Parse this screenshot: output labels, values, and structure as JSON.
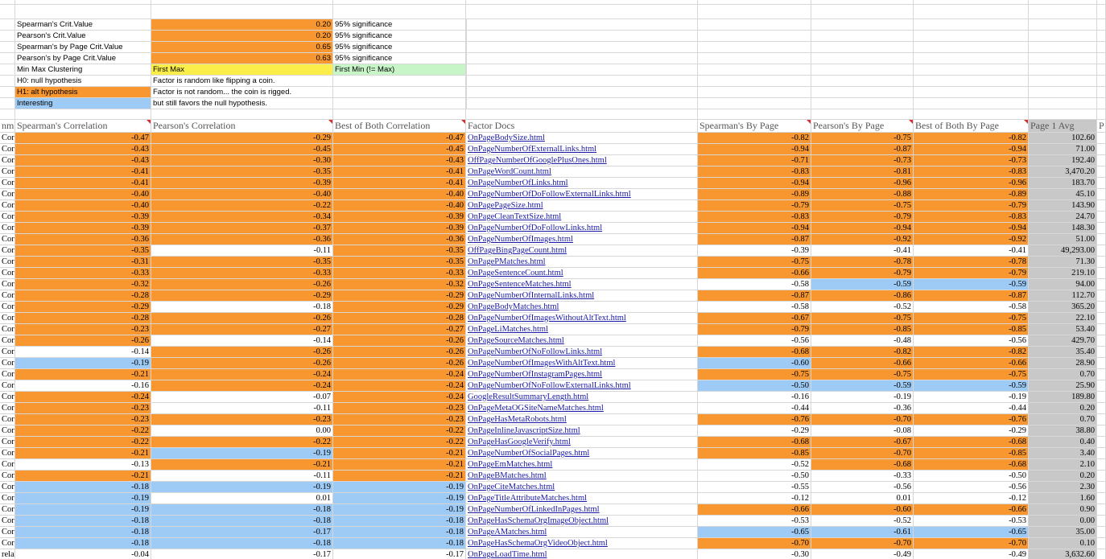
{
  "colors": {
    "orange": "#f8972f",
    "blue": "#9dcbf5",
    "yellow": "#fcee4a",
    "green": "#c7f5c8",
    "gray": "#c8c8c8",
    "link": "#1a1aa6"
  },
  "settings": [
    {
      "label": "Spearman's Crit.Value",
      "label_color": "w",
      "value": "0.20",
      "value_color": "o",
      "note": "95% significance",
      "note_color": "w"
    },
    {
      "label": "Pearson's Crit.Value",
      "label_color": "w",
      "value": "0.20",
      "value_color": "o",
      "note": "95% significance",
      "note_color": "w"
    },
    {
      "label": "Spearman's by Page Crit.Value",
      "label_color": "w",
      "value": "0.65",
      "value_color": "o",
      "note": "95% significance",
      "note_color": "w"
    },
    {
      "label": "Pearson's by Page Crit.Value",
      "label_color": "w",
      "value": "0.63",
      "value_color": "o",
      "note": "95% significance",
      "note_color": "w"
    },
    {
      "label": "Min Max Clustering",
      "label_color": "w",
      "value": "First Max",
      "value_color": "y",
      "note": "First Min (!= Max)",
      "note_color": "g"
    },
    {
      "label": "H0: null hypothesis",
      "label_color": "w",
      "value": "Factor is random like flipping a coin.",
      "value_color": "w",
      "note": "",
      "note_color": "w"
    },
    {
      "label": "H1: alt hypothesis",
      "label_color": "o",
      "value": "Factor is not random... the coin is rigged.",
      "value_color": "w",
      "note": "",
      "note_color": "w"
    },
    {
      "label": "Interesting",
      "label_color": "b",
      "value": "but still favors the null hypothesis.",
      "value_color": "w",
      "note": "",
      "note_color": "w"
    }
  ],
  "headers": {
    "col_a": "nm",
    "spearman": "Spearman's Correlation",
    "pearson": "Pearson's Correlation",
    "both": "Best of Both Correlation",
    "docs": "Factor Docs",
    "spearman_page": "Spearman's By Page",
    "pearson_page": "Pearson's By Page",
    "both_page": "Best of Both By Page",
    "avg": "Page 1 Avg",
    "last": "P"
  },
  "rows": [
    {
      "a": "Corr",
      "sp": "-0.47",
      "pe": "-0.29",
      "bb": "-0.47",
      "doc": "OnPageBodySize.html",
      "spp": "-0.82",
      "pep": "-0.75",
      "bbp": "-0.82",
      "avg": "102.60"
    },
    {
      "a": "Corr",
      "sp": "-0.43",
      "pe": "-0.45",
      "bb": "-0.45",
      "doc": "OnPageNumberOfExternalLinks.html",
      "spp": "-0.94",
      "pep": "-0.87",
      "bbp": "-0.94",
      "avg": "71.00"
    },
    {
      "a": "Corr",
      "sp": "-0.43",
      "pe": "-0.30",
      "bb": "-0.43",
      "doc": "OffPageNumberOfGooglePlusOnes.html",
      "spp": "-0.71",
      "pep": "-0.73",
      "bbp": "-0.73",
      "avg": "192.40"
    },
    {
      "a": "Corr",
      "sp": "-0.41",
      "pe": "-0.35",
      "bb": "-0.41",
      "doc": "OnPageWordCount.html",
      "spp": "-0.83",
      "pep": "-0.81",
      "bbp": "-0.83",
      "avg": "3,470.20"
    },
    {
      "a": "Corr",
      "sp": "-0.41",
      "pe": "-0.39",
      "bb": "-0.41",
      "doc": "OnPageNumberOfLinks.html",
      "spp": "-0.94",
      "pep": "-0.96",
      "bbp": "-0.96",
      "avg": "183.70"
    },
    {
      "a": "Corr",
      "sp": "-0.40",
      "pe": "-0.40",
      "bb": "-0.40",
      "doc": "OnPageNumberOfDoFollowExternalLinks.html",
      "spp": "-0.89",
      "pep": "-0.88",
      "bbp": "-0.89",
      "avg": "45.10"
    },
    {
      "a": "Corr",
      "sp": "-0.40",
      "pe": "-0.22",
      "bb": "-0.40",
      "doc": "OnPagePageSize.html",
      "spp": "-0.79",
      "pep": "-0.75",
      "bbp": "-0.79",
      "avg": "143.90"
    },
    {
      "a": "Corr",
      "sp": "-0.39",
      "pe": "-0.34",
      "bb": "-0.39",
      "doc": "OnPageCleanTextSize.html",
      "spp": "-0.83",
      "pep": "-0.79",
      "bbp": "-0.83",
      "avg": "24.70"
    },
    {
      "a": "Corr",
      "sp": "-0.39",
      "pe": "-0.37",
      "bb": "-0.39",
      "doc": "OnPageNumberOfDoFollowLinks.html",
      "spp": "-0.94",
      "pep": "-0.94",
      "bbp": "-0.94",
      "avg": "148.30"
    },
    {
      "a": "Corr",
      "sp": "-0.36",
      "pe": "-0.36",
      "bb": "-0.36",
      "doc": "OnPageNumberOfImages.html",
      "spp": "-0.87",
      "pep": "-0.92",
      "bbp": "-0.92",
      "avg": "51.00"
    },
    {
      "a": "Corr",
      "sp": "-0.35",
      "pe": "-0.11",
      "bb": "-0.35",
      "doc": "OffPageBingPageCount.html",
      "spp": "-0.39",
      "pep": "-0.41",
      "bbp": "-0.41",
      "avg": "49,293.00"
    },
    {
      "a": "Corr",
      "sp": "-0.31",
      "pe": "-0.35",
      "bb": "-0.35",
      "doc": "OnPagePMatches.html",
      "spp": "-0.75",
      "pep": "-0.78",
      "bbp": "-0.78",
      "avg": "71.30"
    },
    {
      "a": "Corr",
      "sp": "-0.33",
      "pe": "-0.33",
      "bb": "-0.33",
      "doc": "OnPageSentenceCount.html",
      "spp": "-0.66",
      "pep": "-0.79",
      "bbp": "-0.79",
      "avg": "219.10"
    },
    {
      "a": "Corr",
      "sp": "-0.32",
      "pe": "-0.26",
      "bb": "-0.32",
      "doc": "OnPageSentenceMatches.html",
      "spp": "-0.58",
      "pep": "-0.59",
      "bbp": "-0.59",
      "avg": "94.00"
    },
    {
      "a": "Corr",
      "sp": "-0.28",
      "pe": "-0.29",
      "bb": "-0.29",
      "doc": "OnPageNumberOfInternalLinks.html",
      "spp": "-0.87",
      "pep": "-0.86",
      "bbp": "-0.87",
      "avg": "112.70"
    },
    {
      "a": "Corr",
      "sp": "-0.29",
      "pe": "-0.18",
      "bb": "-0.29",
      "doc": "OnPageBodyMatches.html",
      "spp": "-0.58",
      "pep": "-0.52",
      "bbp": "-0.58",
      "avg": "365.20"
    },
    {
      "a": "Corr",
      "sp": "-0.28",
      "pe": "-0.26",
      "bb": "-0.28",
      "doc": "OnPageNumberOfImagesWithoutAltText.html",
      "spp": "-0.67",
      "pep": "-0.75",
      "bbp": "-0.75",
      "avg": "22.10"
    },
    {
      "a": "Corr",
      "sp": "-0.23",
      "pe": "-0.27",
      "bb": "-0.27",
      "doc": "OnPageLiMatches.html",
      "spp": "-0.79",
      "pep": "-0.85",
      "bbp": "-0.85",
      "avg": "53.40"
    },
    {
      "a": "Corr",
      "sp": "-0.26",
      "pe": "-0.14",
      "bb": "-0.26",
      "doc": "OnPageSourceMatches.html",
      "spp": "-0.56",
      "pep": "-0.48",
      "bbp": "-0.56",
      "avg": "429.70"
    },
    {
      "a": "Corr",
      "sp": "-0.14",
      "pe": "-0.26",
      "bb": "-0.26",
      "doc": "OnPageNumberOfNoFollowLinks.html",
      "spp": "-0.68",
      "pep": "-0.82",
      "bbp": "-0.82",
      "avg": "35.40"
    },
    {
      "a": "Corr",
      "sp": "-0.19",
      "pe": "-0.26",
      "bb": "-0.26",
      "doc": "OnPageNumberOfImagesWithAltText.html",
      "spp": "-0.60",
      "pep": "-0.66",
      "bbp": "-0.66",
      "avg": "28.90"
    },
    {
      "a": "Corr",
      "sp": "-0.21",
      "pe": "-0.24",
      "bb": "-0.24",
      "doc": "OnPageNumberOfInstagramPages.html",
      "spp": "-0.75",
      "pep": "-0.75",
      "bbp": "-0.75",
      "avg": "0.70"
    },
    {
      "a": "Corr",
      "sp": "-0.16",
      "pe": "-0.24",
      "bb": "-0.24",
      "doc": "OnPageNumberOfNoFollowExternalLinks.html",
      "spp": "-0.50",
      "pep": "-0.59",
      "bbp": "-0.59",
      "avg": "25.90"
    },
    {
      "a": "Corr",
      "sp": "-0.24",
      "pe": "-0.07",
      "bb": "-0.24",
      "doc": "GoogleResultSummaryLength.html",
      "spp": "-0.16",
      "pep": "-0.19",
      "bbp": "-0.19",
      "avg": "189.80"
    },
    {
      "a": "Corr",
      "sp": "-0.23",
      "pe": "-0.11",
      "bb": "-0.23",
      "doc": "OnPageMetaOGSiteNameMatches.html",
      "spp": "-0.44",
      "pep": "-0.36",
      "bbp": "-0.44",
      "avg": "0.20"
    },
    {
      "a": "Corr",
      "sp": "-0.23",
      "pe": "-0.23",
      "bb": "-0.23",
      "doc": "OnPageHasMetaRobots.html",
      "spp": "-0.76",
      "pep": "-0.70",
      "bbp": "-0.76",
      "avg": "0.70"
    },
    {
      "a": "Corr",
      "sp": "-0.22",
      "pe": "0.00",
      "bb": "-0.22",
      "doc": "OnPageInlineJavascriptSize.html",
      "spp": "-0.29",
      "pep": "-0.08",
      "bbp": "-0.29",
      "avg": "38.80"
    },
    {
      "a": "Corr",
      "sp": "-0.22",
      "pe": "-0.22",
      "bb": "-0.22",
      "doc": "OnPageHasGoogleVerify.html",
      "spp": "-0.68",
      "pep": "-0.67",
      "bbp": "-0.68",
      "avg": "0.40"
    },
    {
      "a": "Corr",
      "sp": "-0.21",
      "pe": "-0.19",
      "bb": "-0.21",
      "doc": "OnPageNumberOfSocialPages.html",
      "spp": "-0.85",
      "pep": "-0.70",
      "bbp": "-0.85",
      "avg": "3.40"
    },
    {
      "a": "Corr",
      "sp": "-0.13",
      "pe": "-0.21",
      "bb": "-0.21",
      "doc": "OnPageEmMatches.html",
      "spp": "-0.52",
      "pep": "-0.68",
      "bbp": "-0.68",
      "avg": "2.10"
    },
    {
      "a": "Corr",
      "sp": "-0.21",
      "pe": "-0.11",
      "bb": "-0.21",
      "doc": "OnPageBMatches.html",
      "spp": "-0.50",
      "pep": "-0.33",
      "bbp": "-0.50",
      "avg": "0.20"
    },
    {
      "a": "Corre",
      "sp": "-0.18",
      "pe": "-0.19",
      "bb": "-0.19",
      "doc": "OnPageCiteMatches.html",
      "spp": "-0.55",
      "pep": "-0.56",
      "bbp": "-0.56",
      "avg": "2.30"
    },
    {
      "a": "Corre",
      "sp": "-0.19",
      "pe": "0.01",
      "bb": "-0.19",
      "doc": "OnPageTitleAttributeMatches.html",
      "spp": "-0.12",
      "pep": "0.01",
      "bbp": "-0.12",
      "avg": "1.60"
    },
    {
      "a": "Corre",
      "sp": "-0.19",
      "pe": "-0.18",
      "bb": "-0.19",
      "doc": "OnPageNumberOfLinkedInPages.html",
      "spp": "-0.66",
      "pep": "-0.60",
      "bbp": "-0.66",
      "avg": "0.90"
    },
    {
      "a": "Corre",
      "sp": "-0.18",
      "pe": "-0.18",
      "bb": "-0.18",
      "doc": "OnPageHasSchemaOrgImageObject.html",
      "spp": "-0.53",
      "pep": "-0.52",
      "bbp": "-0.53",
      "avg": "0.00"
    },
    {
      "a": "Corre",
      "sp": "-0.18",
      "pe": "-0.17",
      "bb": "-0.18",
      "doc": "OnPageAMatches.html",
      "spp": "-0.65",
      "pep": "-0.61",
      "bbp": "-0.65",
      "avg": "35.00"
    },
    {
      "a": "Corre",
      "sp": "-0.18",
      "pe": "-0.18",
      "bb": "-0.18",
      "doc": "OnPageHasSchemaOrgVideoObject.html",
      "spp": "-0.70",
      "pep": "-0.70",
      "bbp": "-0.70",
      "avg": "0.10"
    },
    {
      "a": "relat",
      "sp": "-0.04",
      "pe": "-0.17",
      "bb": "-0.17",
      "doc": "OnPageLoadTime.html",
      "spp": "-0.30",
      "pep": "-0.49",
      "bbp": "-0.49",
      "avg": "3,632.60"
    }
  ],
  "fills": [
    [
      "o",
      "o",
      "o",
      "o",
      "o",
      "o"
    ],
    [
      "o",
      "o",
      "o",
      "o",
      "o",
      "o"
    ],
    [
      "o",
      "o",
      "o",
      "o",
      "o",
      "o"
    ],
    [
      "o",
      "o",
      "o",
      "o",
      "o",
      "o"
    ],
    [
      "o",
      "o",
      "o",
      "o",
      "o",
      "o"
    ],
    [
      "o",
      "o",
      "o",
      "o",
      "o",
      "o"
    ],
    [
      "o",
      "o",
      "o",
      "o",
      "o",
      "o"
    ],
    [
      "o",
      "o",
      "o",
      "o",
      "o",
      "o"
    ],
    [
      "o",
      "o",
      "o",
      "o",
      "o",
      "o"
    ],
    [
      "o",
      "o",
      "o",
      "o",
      "o",
      "o"
    ],
    [
      "o",
      "w",
      "o",
      "w",
      "w",
      "w"
    ],
    [
      "o",
      "o",
      "o",
      "o",
      "o",
      "o"
    ],
    [
      "o",
      "o",
      "o",
      "o",
      "o",
      "o"
    ],
    [
      "o",
      "o",
      "o",
      "w",
      "b",
      "b"
    ],
    [
      "o",
      "o",
      "o",
      "o",
      "o",
      "o"
    ],
    [
      "o",
      "w",
      "o",
      "w",
      "w",
      "w"
    ],
    [
      "o",
      "o",
      "o",
      "o",
      "o",
      "o"
    ],
    [
      "o",
      "o",
      "o",
      "o",
      "o",
      "o"
    ],
    [
      "o",
      "w",
      "o",
      "w",
      "w",
      "w"
    ],
    [
      "w",
      "o",
      "o",
      "o",
      "o",
      "o"
    ],
    [
      "b",
      "o",
      "o",
      "b",
      "o",
      "o"
    ],
    [
      "o",
      "o",
      "o",
      "o",
      "o",
      "o"
    ],
    [
      "w",
      "o",
      "o",
      "b",
      "b",
      "b"
    ],
    [
      "o",
      "w",
      "o",
      "w",
      "w",
      "w"
    ],
    [
      "o",
      "w",
      "o",
      "w",
      "w",
      "w"
    ],
    [
      "o",
      "o",
      "o",
      "o",
      "o",
      "o"
    ],
    [
      "o",
      "w",
      "o",
      "w",
      "w",
      "w"
    ],
    [
      "o",
      "o",
      "o",
      "o",
      "o",
      "o"
    ],
    [
      "o",
      "b",
      "o",
      "o",
      "o",
      "o"
    ],
    [
      "w",
      "o",
      "o",
      "w",
      "o",
      "o"
    ],
    [
      "o",
      "w",
      "o",
      "w",
      "w",
      "w"
    ],
    [
      "b",
      "b",
      "b",
      "w",
      "w",
      "w"
    ],
    [
      "b",
      "w",
      "b",
      "w",
      "w",
      "w"
    ],
    [
      "b",
      "b",
      "b",
      "o",
      "o",
      "o"
    ],
    [
      "b",
      "b",
      "b",
      "w",
      "w",
      "w"
    ],
    [
      "b",
      "b",
      "b",
      "b",
      "b",
      "b"
    ],
    [
      "b",
      "b",
      "b",
      "o",
      "o",
      "o"
    ],
    [
      "w",
      "w",
      "w",
      "w",
      "w",
      "w"
    ]
  ]
}
